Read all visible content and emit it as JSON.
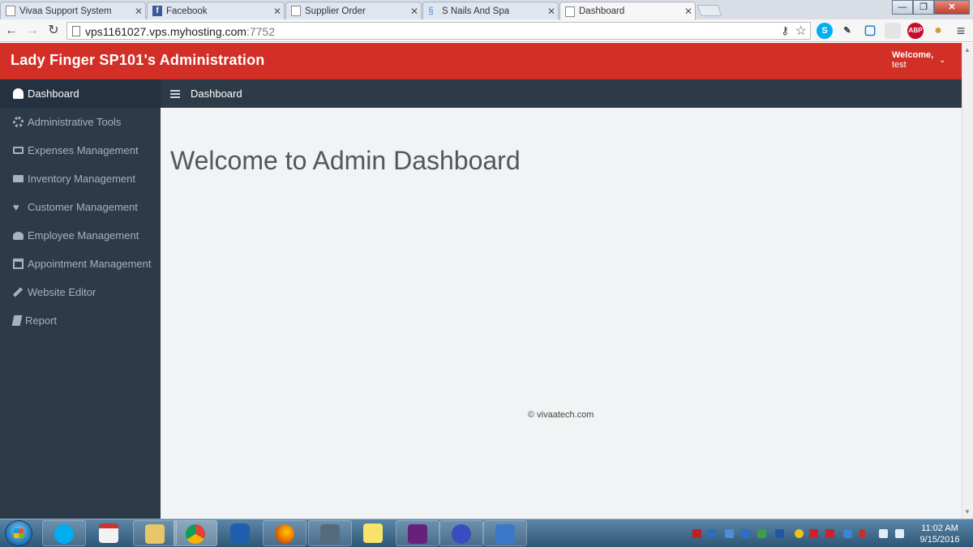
{
  "browser": {
    "tabs": [
      {
        "title": "Vivaa Support System",
        "icon": "page-icon",
        "active": false
      },
      {
        "title": "Facebook",
        "icon": "facebook-icon",
        "active": false
      },
      {
        "title": "Supplier Order",
        "icon": "page-icon",
        "active": false
      },
      {
        "title": "S Nails And Spa",
        "icon": "s-nails-icon",
        "active": false
      },
      {
        "title": "Dashboard",
        "icon": "page-icon",
        "active": true
      }
    ],
    "close_glyph": "✕",
    "window_buttons": {
      "minimize": "—",
      "maximize": "❐",
      "close": "✕"
    },
    "nav": {
      "back": "←",
      "forward": "→",
      "reload": "↻"
    },
    "url_host": "vps1161027.vps.myhosting.com",
    "url_port": ":7752",
    "extensions": [
      {
        "name": "skype-icon",
        "label": "S",
        "color": "#00aff0"
      },
      {
        "name": "eyedropper-icon",
        "label": "✎",
        "color": "#555555"
      },
      {
        "name": "screenshot-icon",
        "label": "▢",
        "color": "#2a7fd4"
      },
      {
        "name": "blank-extension-icon",
        "label": "",
        "color": "#e0e0e0"
      },
      {
        "name": "adblock-icon",
        "label": "ABP",
        "color": "#c70d2c"
      },
      {
        "name": "cookie-icon",
        "label": "●",
        "color": "#d79a3a"
      },
      {
        "name": "chrome-menu-icon",
        "label": "≡",
        "color": "#f6f6f6"
      }
    ]
  },
  "header": {
    "brand": "Lady Finger SP101's Administration",
    "welcome_line1": "Welcome,",
    "welcome_line2": "test",
    "caret": "⌄",
    "color": "#d22f27"
  },
  "sidebar": {
    "items": [
      {
        "label": "Dashboard",
        "icon": "dashboard-icon",
        "active": true
      },
      {
        "label": "Administrative Tools",
        "icon": "gears-icon",
        "active": false
      },
      {
        "label": "Expenses Management",
        "icon": "money-icon",
        "active": false
      },
      {
        "label": "Inventory Management",
        "icon": "truck-icon",
        "active": false
      },
      {
        "label": "Customer Management",
        "icon": "heart-icon",
        "active": false
      },
      {
        "label": "Employee Management",
        "icon": "users-icon",
        "active": false
      },
      {
        "label": "Appointment Management",
        "icon": "calendar-icon",
        "active": false
      },
      {
        "label": "Website Editor",
        "icon": "paint-brush-icon",
        "active": false
      },
      {
        "label": "Report",
        "icon": "book-icon",
        "active": false
      }
    ],
    "color": "#2d3a48"
  },
  "content": {
    "breadcrumb": "Dashboard",
    "title": "Welcome to Admin Dashboard",
    "footer": "© vivaatech.com"
  },
  "taskbar": {
    "apps": [
      "skype-app-icon",
      "calendar-app-icon",
      "file-explorer-icon",
      "chrome-app-icon",
      "blue-shield-app-icon",
      "firefox-app-icon",
      "build-tools-app-icon",
      "sticky-notes-app-icon",
      "visual-studio-app-icon",
      "infinity-app-icon",
      "remote-desktop-app-icon"
    ],
    "clock_time": "11:02 AM",
    "clock_date": "9/15/2016"
  }
}
